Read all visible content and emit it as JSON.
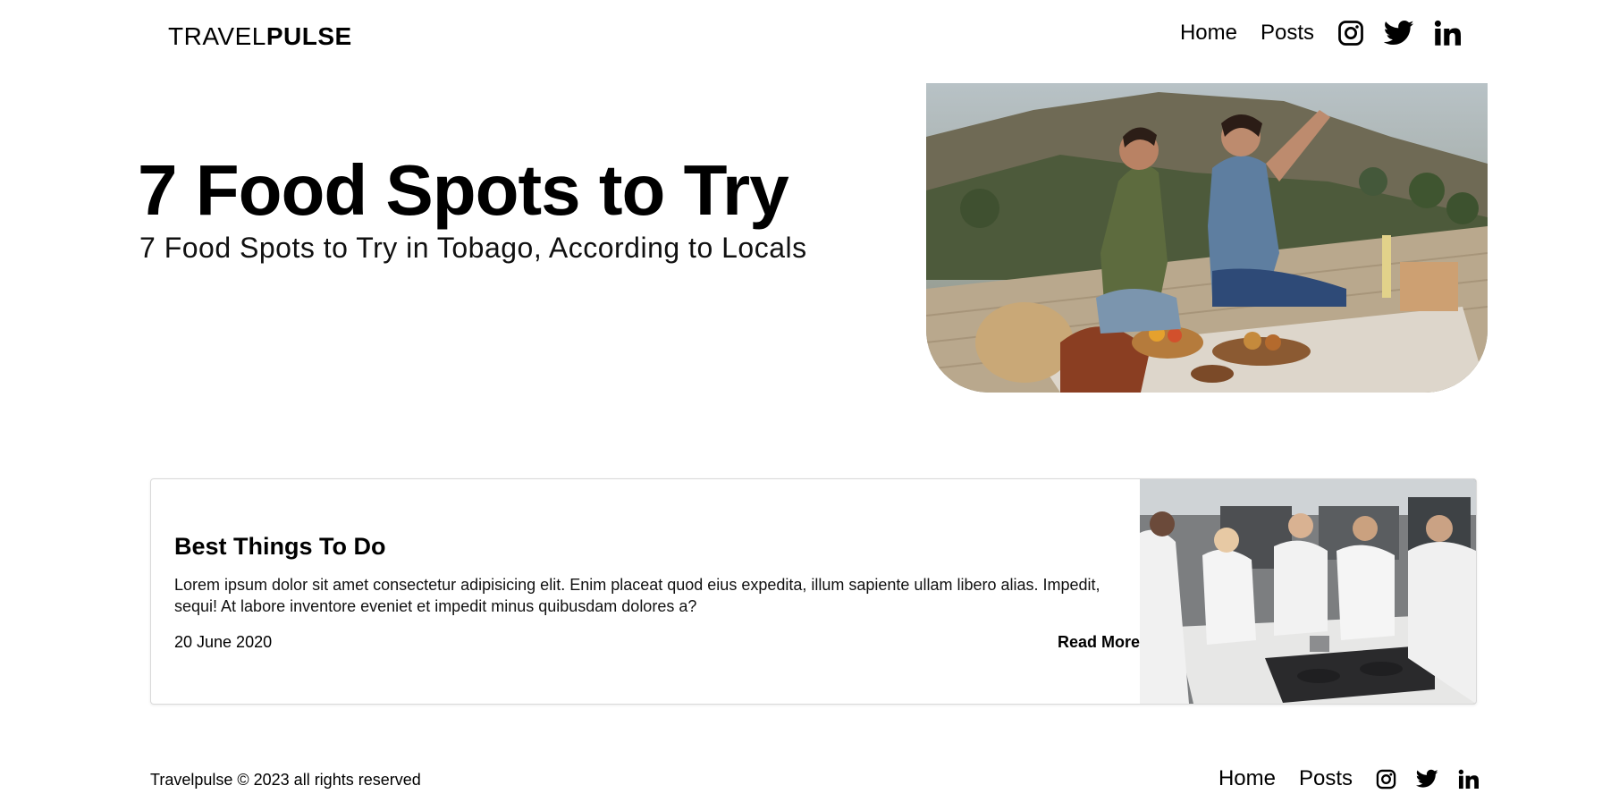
{
  "header": {
    "logo_light": "TRAVEL",
    "logo_bold": "PULSE",
    "nav": {
      "home": "Home",
      "posts": "Posts"
    },
    "icons": [
      "instagram-icon",
      "twitter-icon",
      "linkedin-icon"
    ]
  },
  "hero": {
    "title": "7 Food Spots to Try",
    "subtitle": "7 Food Spots to Try in Tobago, According to Locals"
  },
  "card": {
    "title": "Best Things To Do",
    "text": "Lorem ipsum dolor sit amet consectetur adipisicing elit. Enim placeat quod eius expedita, illum sapiente ullam libero alias. Impedit, sequi! At labore inventore eveniet et impedit minus quibusdam dolores a?",
    "date": "20 June 2020",
    "read_more": "Read More"
  },
  "footer": {
    "copyright": "Travelpulse © 2023 all rights reserved",
    "nav": {
      "home": "Home",
      "posts": "Posts"
    }
  }
}
